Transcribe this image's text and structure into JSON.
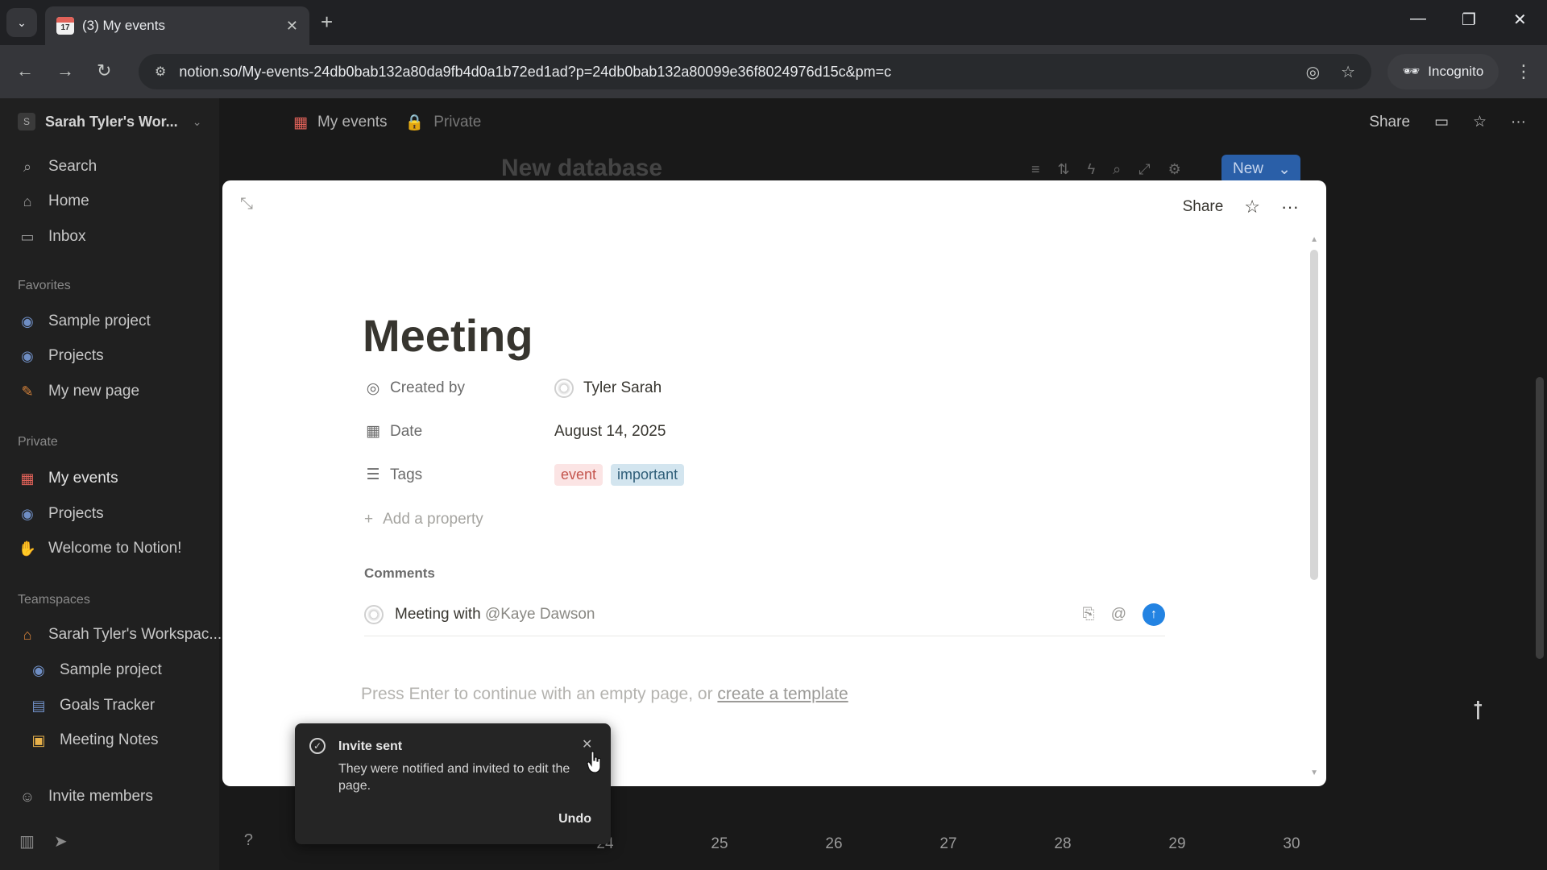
{
  "browser": {
    "tab_title": "(3) My events",
    "tab_favicon_day": "17",
    "url": "notion.so/My-events-24db0bab132a80da9fb4d0a1b72ed1ad?p=24db0bab132a80099e36f8024976d15c&pm=c",
    "incognito_label": "Incognito"
  },
  "sidebar": {
    "workspace_initial": "S",
    "workspace_name": "Sarah Tyler's Wor...",
    "nav": [
      {
        "label": "Search",
        "icon": "search-icon"
      },
      {
        "label": "Home",
        "icon": "home-icon"
      },
      {
        "label": "Inbox",
        "icon": "inbox-icon"
      }
    ],
    "favorites_label": "Favorites",
    "favorites": [
      {
        "label": "Sample project",
        "icon": "project-icon"
      },
      {
        "label": "Projects",
        "icon": "project-icon"
      },
      {
        "label": "My new page",
        "icon": "pencil-icon"
      }
    ],
    "private_label": "Private",
    "private": [
      {
        "label": "My events",
        "icon": "calendar-icon"
      },
      {
        "label": "Projects",
        "icon": "project-icon"
      },
      {
        "label": "Welcome to Notion!",
        "icon": "wave-icon"
      }
    ],
    "teamspaces_label": "Teamspaces",
    "teamspace_name": "Sarah Tyler's Workspac...",
    "teamspace_items": [
      {
        "label": "Sample project",
        "icon": "project-icon"
      },
      {
        "label": "Goals Tracker",
        "icon": "chart-icon"
      },
      {
        "label": "Meeting Notes",
        "icon": "folder-icon"
      }
    ],
    "invite_label": "Invite members"
  },
  "topbar": {
    "breadcrumb_page": "My events",
    "breadcrumb_privacy": "Private",
    "share_label": "Share"
  },
  "database": {
    "title": "New database",
    "new_button": "New",
    "calendar_days": [
      "24",
      "25",
      "26",
      "27",
      "28",
      "29",
      "30"
    ]
  },
  "modal": {
    "share_label": "Share",
    "title": "Meeting",
    "properties": {
      "created_by_label": "Created by",
      "created_by_value": "Tyler Sarah",
      "date_label": "Date",
      "date_value": "August 14, 2025",
      "tags_label": "Tags",
      "tags": [
        {
          "label": "event",
          "color": "#fbe4e4"
        },
        {
          "label": "important",
          "color": "#d3e5ef"
        }
      ],
      "add_property_label": "Add a property"
    },
    "comments_heading": "Comments",
    "comment_text": "Meeting with",
    "comment_mention": "@Kaye Dawson",
    "empty_hint": "Press Enter to continue with an empty page, or",
    "create_template_link": "create a template"
  },
  "toast": {
    "title": "Invite sent",
    "message": "They were notified and invited to edit the page.",
    "undo_label": "Undo"
  },
  "colors": {
    "accent_blue": "#2383e2",
    "new_button_bg": "#2a5fa8"
  }
}
